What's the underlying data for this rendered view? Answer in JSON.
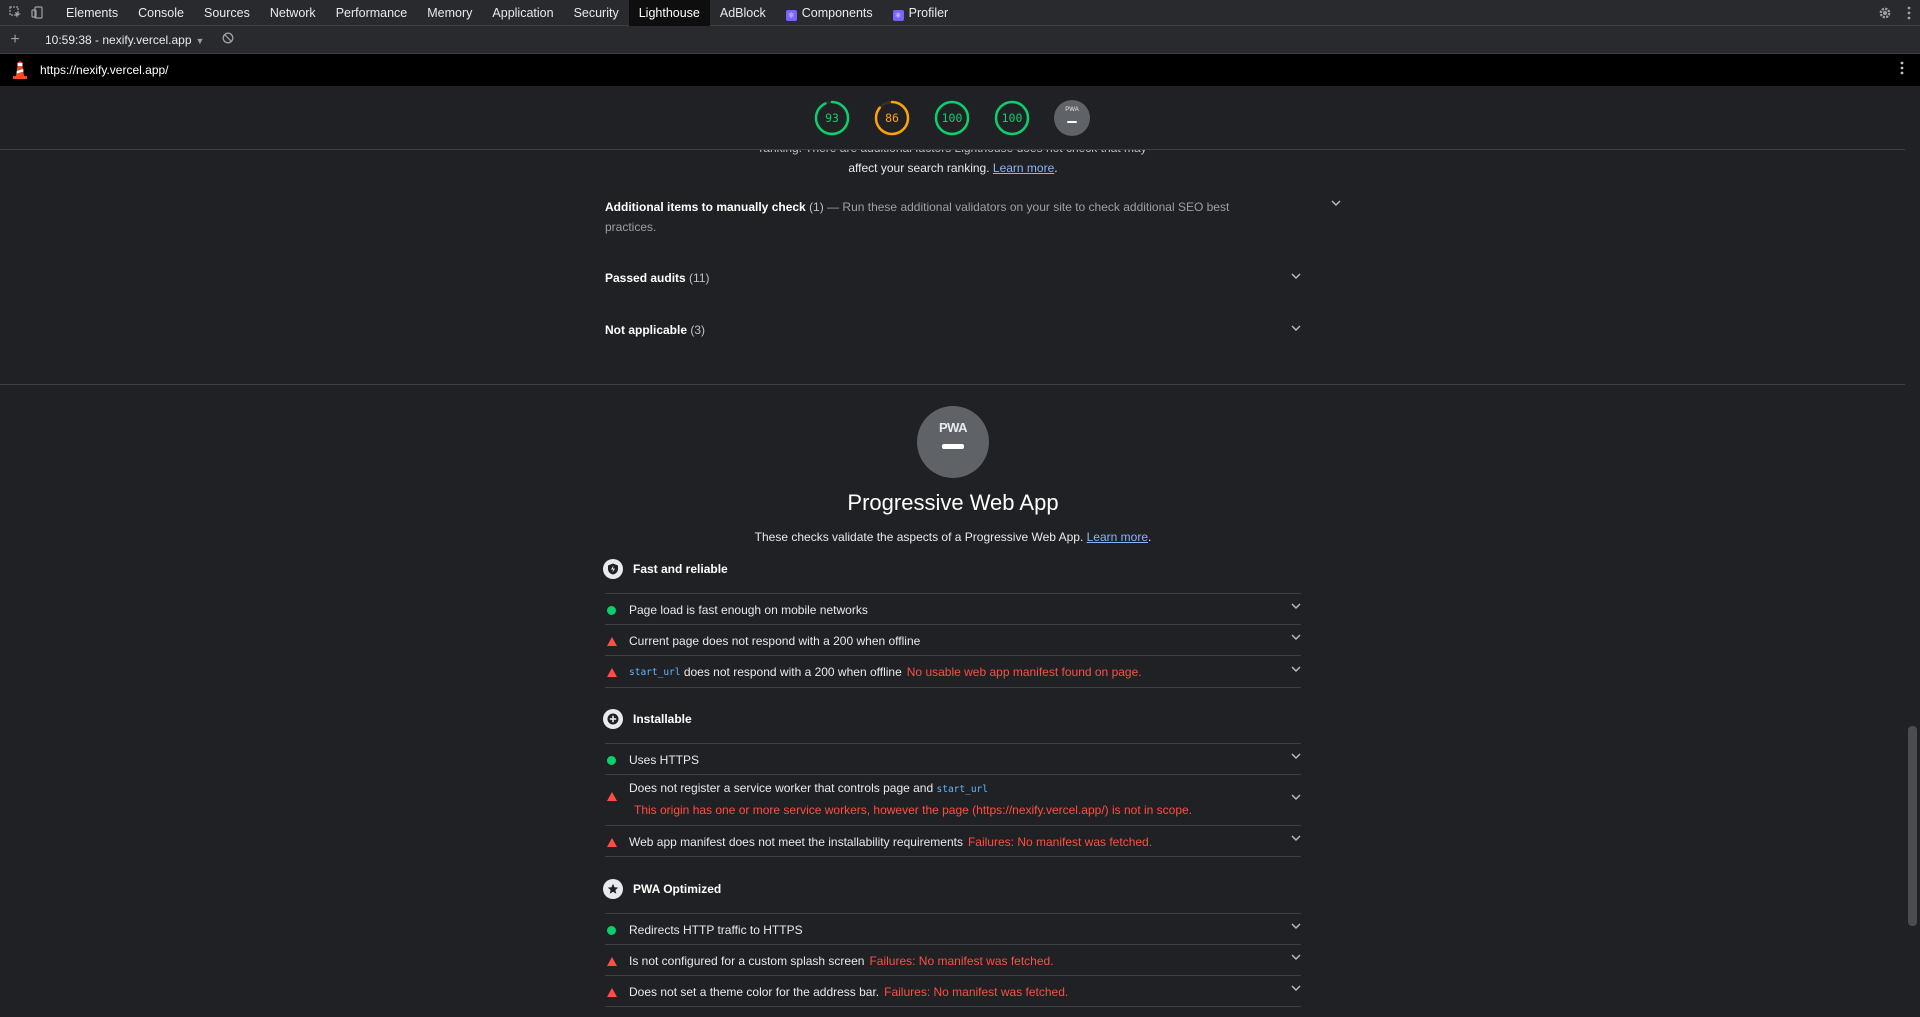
{
  "devtools": {
    "tabs": [
      {
        "label": "Elements"
      },
      {
        "label": "Console"
      },
      {
        "label": "Sources"
      },
      {
        "label": "Network"
      },
      {
        "label": "Performance"
      },
      {
        "label": "Memory"
      },
      {
        "label": "Application"
      },
      {
        "label": "Security"
      },
      {
        "label": "Lighthouse",
        "active": true
      },
      {
        "label": "AdBlock"
      },
      {
        "label": "Components"
      },
      {
        "label": "Profiler"
      }
    ],
    "report_selector": "10:59:38 - nexify.vercel.app",
    "url": "https://nexify.vercel.app/"
  },
  "gauges": [
    {
      "score": "93",
      "color": "#0cce6b",
      "fraction": 0.93
    },
    {
      "score": "86",
      "color": "#ffa400",
      "fraction": 0.86
    },
    {
      "score": "100",
      "color": "#0cce6b",
      "fraction": 1.0
    },
    {
      "score": "100",
      "color": "#0cce6b",
      "fraction": 1.0
    }
  ],
  "pwa_mini_label": "PWA",
  "seo": {
    "desc_partial": "ranking. There are additional factors Lighthouse does not check that may",
    "desc_line2": "affect your search ranking.",
    "learn_more": "Learn more",
    "groups": [
      {
        "title": "Additional items to manually check",
        "count": "(1)",
        "sep": " — ",
        "desc": "Run these additional validators on your site to check additional SEO best practices."
      },
      {
        "title": "Passed audits",
        "count": "(11)"
      },
      {
        "title": "Not applicable",
        "count": "(3)"
      }
    ]
  },
  "pwa": {
    "badge_text": "PWA",
    "title": "Progressive Web App",
    "desc": "These checks validate the aspects of a Progressive Web App.",
    "learn_more": "Learn more",
    "groups": {
      "fast": {
        "label": "Fast and reliable",
        "audits": [
          {
            "status": "pass",
            "text": "Page load is fast enough on mobile networks"
          },
          {
            "status": "fail",
            "text": "Current page does not respond with a 200 when offline"
          },
          {
            "status": "fail",
            "code": "start_url",
            "text": "does not respond with a 200 when offline",
            "error": "No usable web app manifest found on page."
          }
        ]
      },
      "installable": {
        "label": "Installable",
        "audits": [
          {
            "status": "pass",
            "text": "Uses HTTPS"
          },
          {
            "status": "fail",
            "text": "Does not register a service worker that controls page and",
            "code": "start_url",
            "error": "This origin has one or more service workers, however the page (https://nexify.vercel.app/) is not in scope."
          },
          {
            "status": "fail",
            "text": "Web app manifest does not meet the installability requirements",
            "error": "Failures: No manifest was fetched."
          }
        ]
      },
      "optimized": {
        "label": "PWA Optimized",
        "audits": [
          {
            "status": "pass",
            "text": "Redirects HTTP traffic to HTTPS"
          },
          {
            "status": "fail",
            "text": "Is not configured for a custom splash screen",
            "error": "Failures: No manifest was fetched."
          },
          {
            "status": "fail",
            "text": "Does not set a theme color for the address bar.",
            "error": "Failures: No manifest was fetched."
          }
        ]
      }
    }
  }
}
